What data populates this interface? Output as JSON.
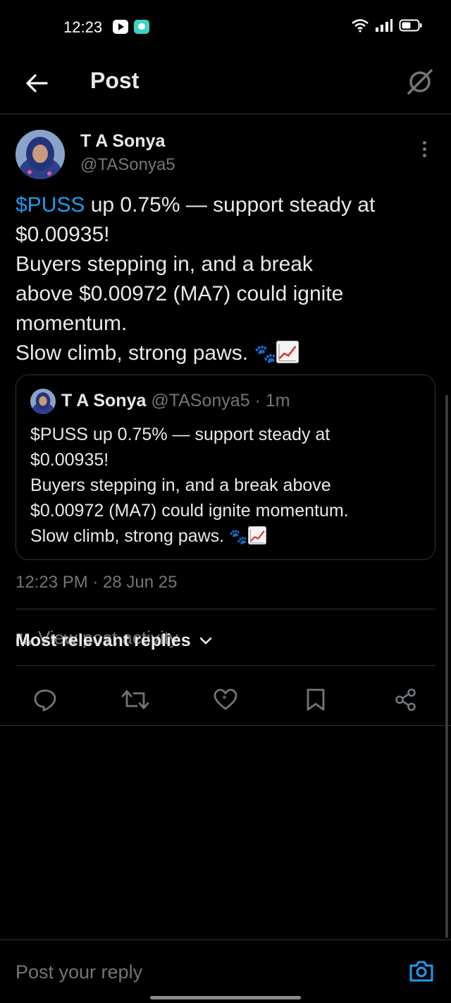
{
  "status_bar": {
    "time": "12:23",
    "icons": [
      "youtube-icon",
      "chat-app-icon",
      "wifi-icon",
      "signal-icon",
      "battery-icon"
    ]
  },
  "header": {
    "title": "Post",
    "back_icon": "arrow-left-icon",
    "right_icon": "grok-icon"
  },
  "post": {
    "author_name": "T A Sonya",
    "author_handle": "@TASonya5",
    "cashtag": "$PUSS",
    "text_line1_rest": " up 0.75% — support steady at",
    "text_line2": "$0.00935!",
    "text_line3": "Buyers stepping in, and a break",
    "text_line4": "above $0.00972 (MA7) could ignite",
    "text_line5": "momentum.",
    "text_line6": "Slow climb, strong paws. ",
    "paw_emoji": "🐾",
    "timestamp": "12:23 PM · 28 Jun 25"
  },
  "quote": {
    "author_name": "T A Sonya",
    "author_handle_time": " @TASonya5 · 1m",
    "line1": "$PUSS up 0.75% — support steady at",
    "line2": "$0.00935!",
    "line3": "Buyers stepping in, and a break above",
    "line4": "$0.00972 (MA7) could ignite momentum.",
    "line5": "Slow climb, strong paws. ",
    "paw_emoji": "🐾"
  },
  "activity": {
    "label": "View post activity"
  },
  "actions": [
    "reply-icon",
    "repost-icon",
    "like-icon",
    "bookmark-icon",
    "share-icon"
  ],
  "replies": {
    "sort_label": "Most relevant replies"
  },
  "compose": {
    "placeholder": "Post your reply"
  },
  "colors": {
    "accent": "#1d9bf0",
    "secondary_text": "#71767b",
    "divider": "#2f3336"
  }
}
